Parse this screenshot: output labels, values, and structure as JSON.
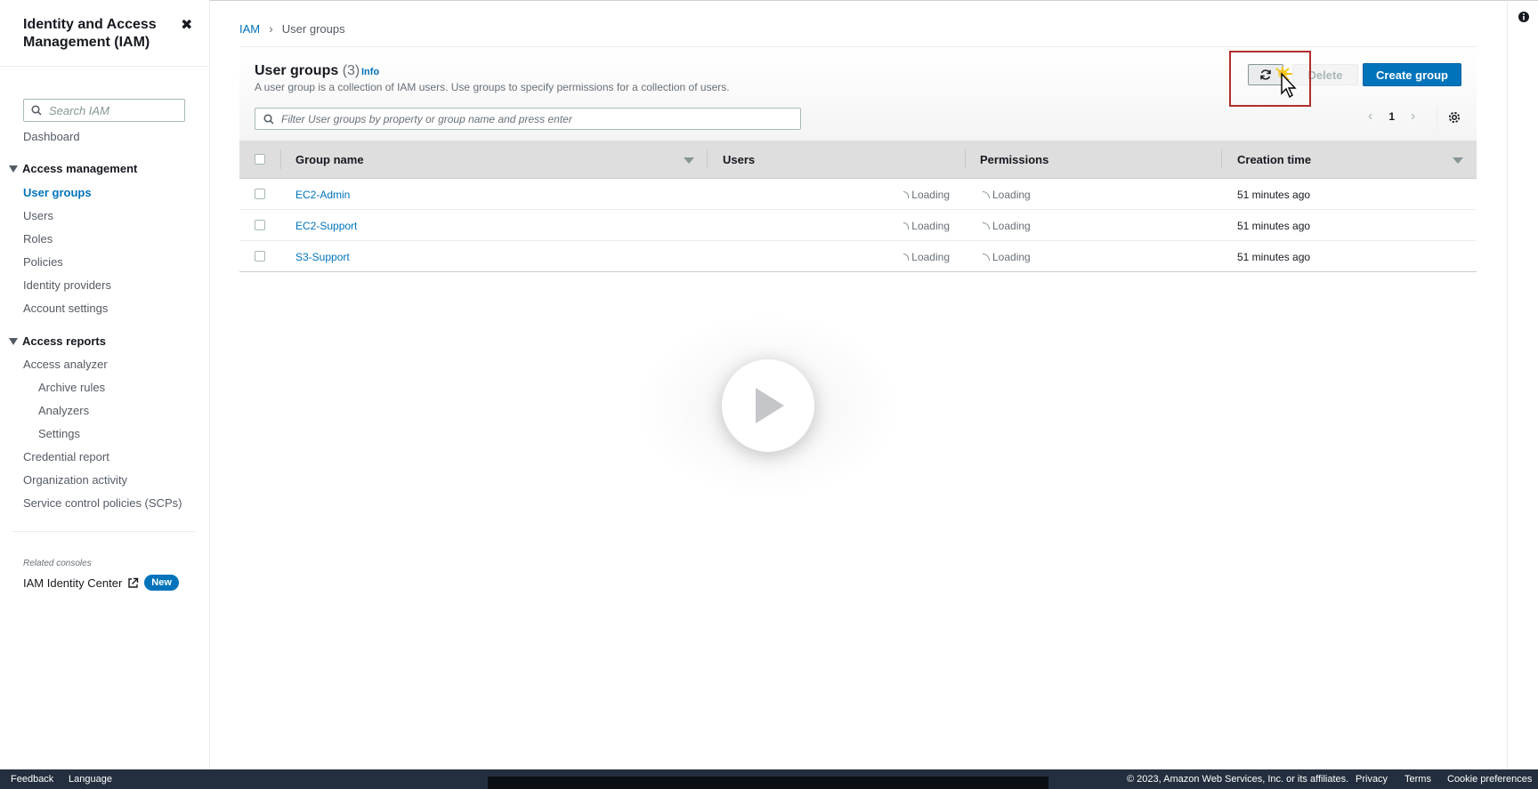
{
  "sidebar": {
    "title": "Identity and Access Management (IAM)",
    "search_placeholder": "Search IAM",
    "dashboard": "Dashboard",
    "sections": {
      "access_management": {
        "label": "Access management",
        "items": [
          "User groups",
          "Users",
          "Roles",
          "Policies",
          "Identity providers",
          "Account settings"
        ]
      },
      "access_reports": {
        "label": "Access reports",
        "items": [
          "Access analyzer",
          "Archive rules",
          "Analyzers",
          "Settings",
          "Credential report",
          "Organization activity",
          "Service control policies (SCPs)"
        ]
      }
    },
    "related_label": "Related consoles",
    "identity_center": "IAM Identity Center",
    "new_badge": "New"
  },
  "breadcrumb": {
    "root": "IAM",
    "current": "User groups"
  },
  "header": {
    "title": "User groups",
    "count": "(3)",
    "info": "Info",
    "description": "A user group is a collection of IAM users. Use groups to specify permissions for a collection of users."
  },
  "buttons": {
    "delete": "Delete",
    "create": "Create group"
  },
  "filter": {
    "placeholder": "Filter User groups by property or group name and press enter"
  },
  "pagination": {
    "page": "1"
  },
  "table": {
    "columns": [
      "Group name",
      "Users",
      "Permissions",
      "Creation time"
    ],
    "rows": [
      {
        "name": "EC2-Admin",
        "users": "Loading",
        "permissions": "Loading",
        "created": "51 minutes ago"
      },
      {
        "name": "EC2-Support",
        "users": "Loading",
        "permissions": "Loading",
        "created": "51 minutes ago"
      },
      {
        "name": "S3-Support",
        "users": "Loading",
        "permissions": "Loading",
        "created": "51 minutes ago"
      }
    ]
  },
  "footer": {
    "feedback": "Feedback",
    "language": "Language",
    "copyright": "© 2023, Amazon Web Services, Inc. or its affiliates.",
    "privacy": "Privacy",
    "terms": "Terms",
    "cookies": "Cookie preferences"
  },
  "colors": {
    "accent": "#0073bb",
    "footer_bg": "#232f3e",
    "highlight": "#b32d2d"
  },
  "icons": [
    "close-icon",
    "search-icon",
    "caret-down-icon",
    "external-link-icon",
    "refresh-icon",
    "settings-gear-icon",
    "info-icon",
    "play-icon",
    "cursor-icon",
    "spinner-icon"
  ]
}
